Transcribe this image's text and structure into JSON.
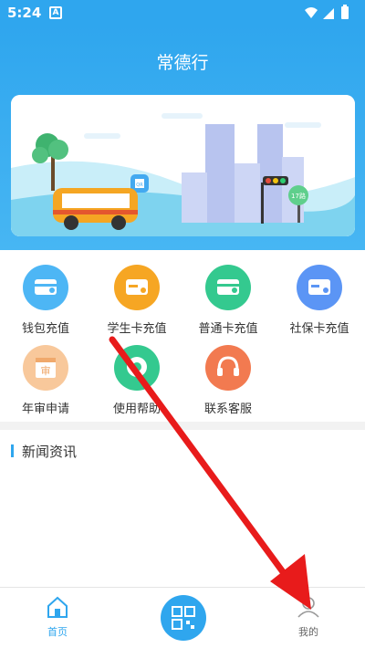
{
  "status_bar": {
    "time": "5:24",
    "notification_badge": "A",
    "icons": [
      "wifi-icon",
      "signal-icon",
      "battery-icon"
    ]
  },
  "header": {
    "title": "常德行"
  },
  "banner": {
    "qr_label": "QR",
    "sign_label": "17路"
  },
  "services": [
    {
      "label": "钱包充值",
      "icon": "wallet-card-icon",
      "color": "#4db6f5"
    },
    {
      "label": "学生卡充值",
      "icon": "student-card-icon",
      "color": "#f6a623"
    },
    {
      "label": "普通卡充值",
      "icon": "normal-card-icon",
      "color": "#34c98f"
    },
    {
      "label": "社保卡充值",
      "icon": "social-card-icon",
      "color": "#5b95f5"
    },
    {
      "label": "年审申请",
      "icon": "calendar-icon",
      "glyph": "审",
      "color": "#f8c89b"
    },
    {
      "label": "使用帮助",
      "icon": "help-icon",
      "color": "#34c98f"
    },
    {
      "label": "联系客服",
      "icon": "headset-icon",
      "color": "#f27a50"
    }
  ],
  "news": {
    "section_title": "新闻资讯"
  },
  "bottom_nav": {
    "home_label": "首页",
    "mine_label": "我的",
    "qr_icon": "qr-code-icon"
  },
  "colors": {
    "brand": "#2fa6ee",
    "arrow": "#e81b1b"
  }
}
